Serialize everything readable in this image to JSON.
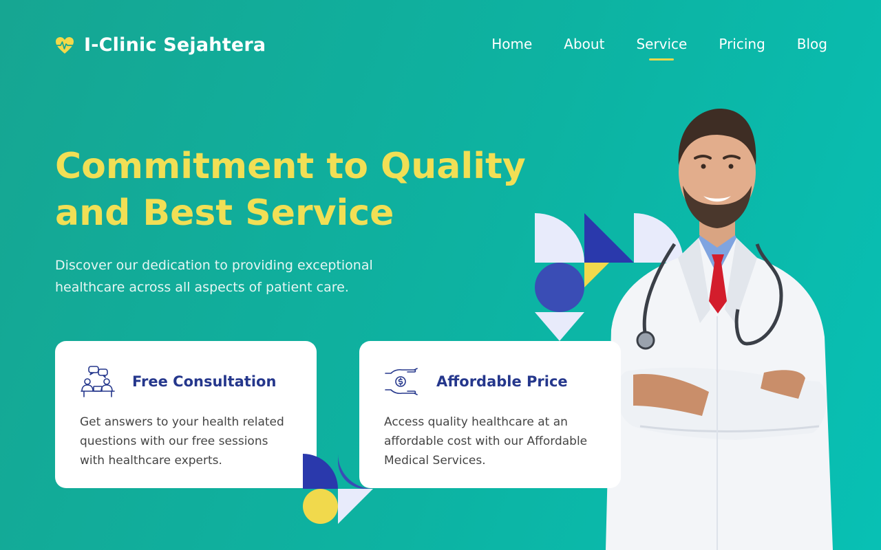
{
  "brand": {
    "name": "I-Clinic Sejahtera",
    "icon": "heart-pulse-icon",
    "icon_color": "#f3d94a"
  },
  "nav": {
    "items": [
      {
        "label": "Home"
      },
      {
        "label": "About"
      },
      {
        "label": "Service",
        "active": true
      },
      {
        "label": "Pricing"
      },
      {
        "label": "Blog"
      }
    ],
    "active_underline_color": "#f3d94a"
  },
  "hero": {
    "title_line1": "Commitment to Quality",
    "title_line2": "and Best Service",
    "subtitle": "Discover our dedication to providing exceptional healthcare across all aspects of patient care."
  },
  "cards": [
    {
      "icon": "consultation-icon",
      "title": "Free Consultation",
      "text": "Get answers to your health related questions with our free sessions with healthcare experts."
    },
    {
      "icon": "hand-coin-icon",
      "title": "Affordable Price",
      "text": "Access quality healthcare at an affordable cost with our Affordable Medical Services."
    }
  ],
  "colors": {
    "accent_yellow": "#f1df55",
    "brand_blue": "#25378c",
    "deco_blue": "#3a4db5",
    "deco_lavender": "#e8ebfb"
  }
}
